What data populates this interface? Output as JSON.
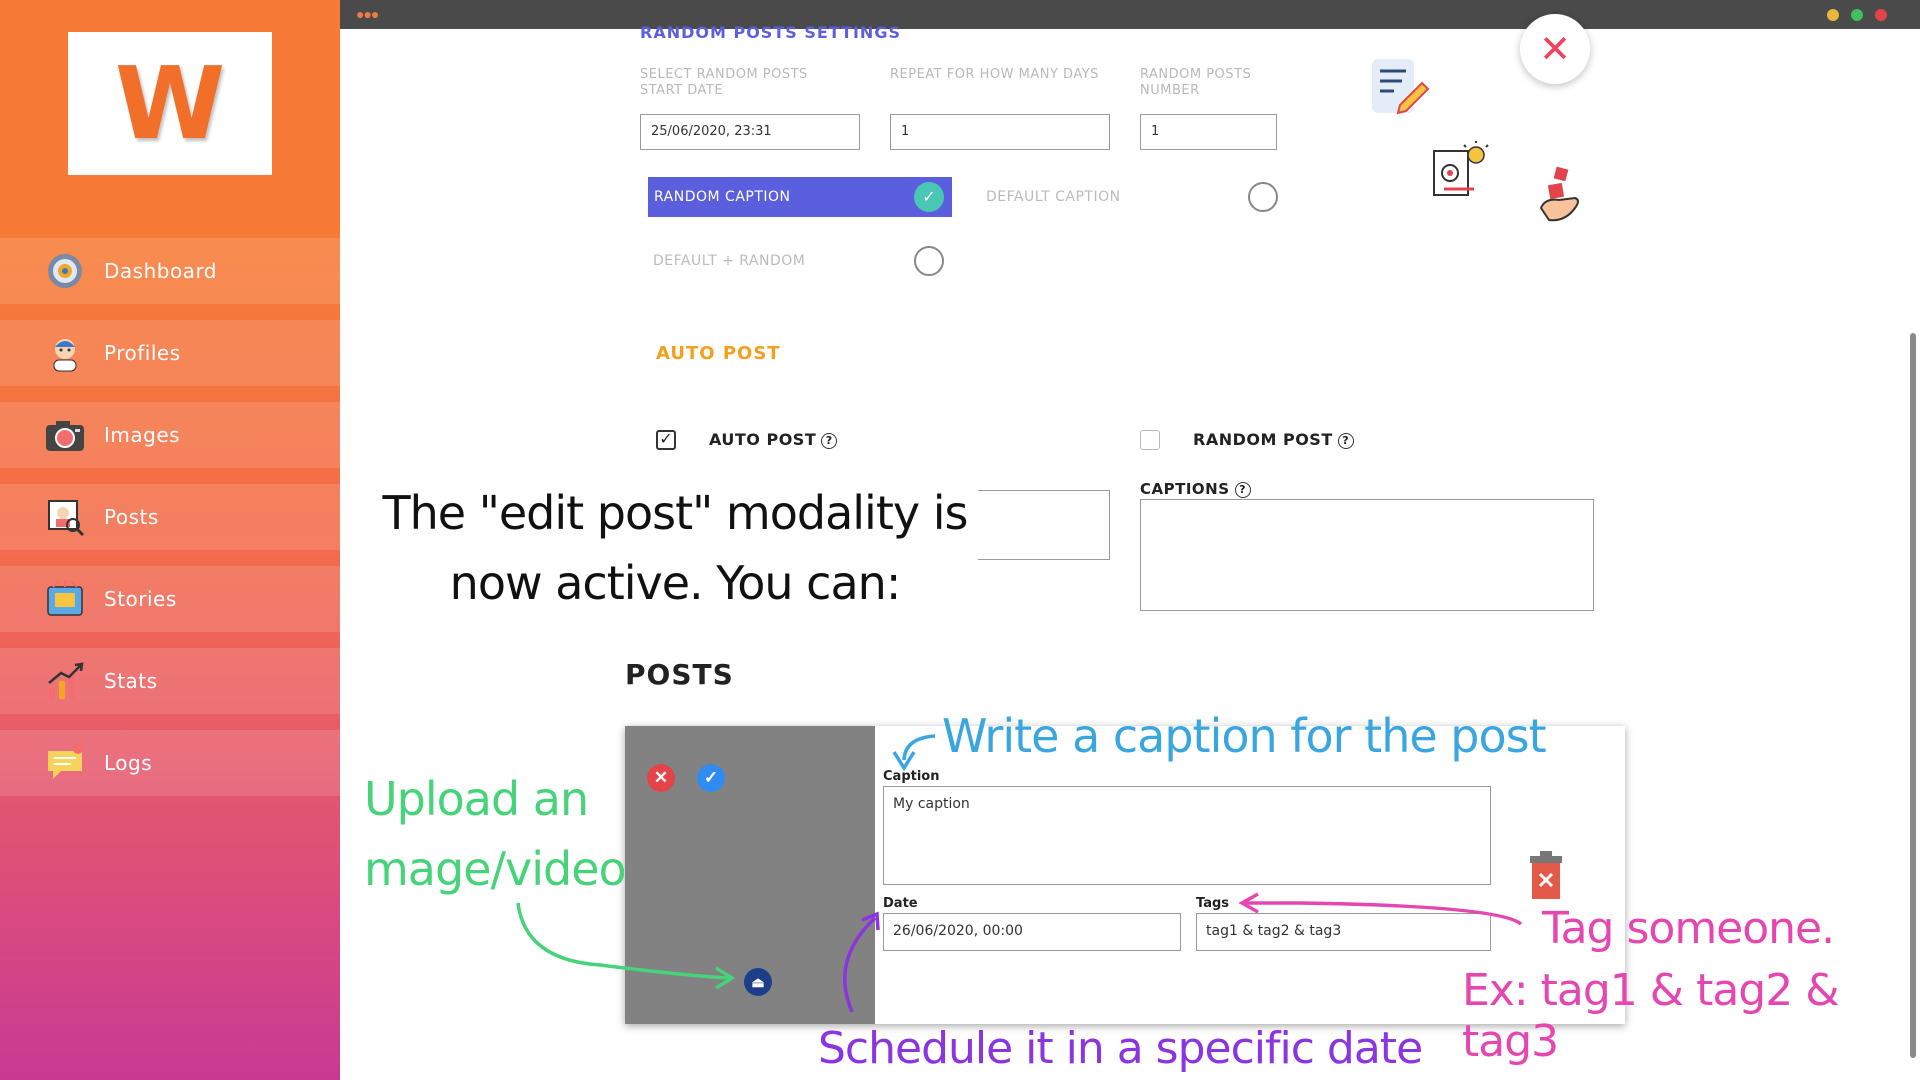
{
  "app": {
    "logo_letter": "W",
    "accent": "#f77b36",
    "brand_purple": "#5b5fde"
  },
  "sidebar": {
    "items": [
      {
        "label": "Dashboard",
        "icon": "dashboard-icon"
      },
      {
        "label": "Profiles",
        "icon": "profile-icon"
      },
      {
        "label": "Images",
        "icon": "camera-icon"
      },
      {
        "label": "Posts",
        "icon": "posts-icon"
      },
      {
        "label": "Stories",
        "icon": "stories-icon"
      },
      {
        "label": "Stats",
        "icon": "stats-icon"
      },
      {
        "label": "Logs",
        "icon": "logs-icon"
      }
    ]
  },
  "random_settings": {
    "title": "RANDOM POSTS SETTINGS",
    "start_date_label": "SELECT RANDOM POSTS START DATE",
    "start_date_value": "25/06/2020, 23:31",
    "repeat_label": "REPEAT FOR HOW MANY DAYS",
    "repeat_value": "1",
    "number_label": "RANDOM POSTS NUMBER",
    "number_value": "1",
    "caption_options": {
      "random": "RANDOM CAPTION",
      "default": "DEFAULT CAPTION",
      "default_random": "DEFAULT + RANDOM"
    },
    "selected_caption": "RANDOM CAPTION"
  },
  "auto_post": {
    "title": "AUTO POST",
    "auto_post_label": "AUTO POST",
    "auto_post_checked": true,
    "random_post_label": "RANDOM POST",
    "random_post_checked": false,
    "captions_label": "CAPTIONS",
    "help_glyph": "?"
  },
  "tutorial": {
    "headline_line1": "The \"edit post\" modality is",
    "headline_line2": "now active. You can:",
    "caption_note": "Write a caption for the post",
    "upload_note_line1": "Upload an",
    "upload_note_line2": "mage/video",
    "tag_note_line1": "Tag someone.",
    "tag_note_line2": "Ex: tag1 & tag2 & tag3",
    "schedule_note": "Schedule it in a specific date"
  },
  "posts": {
    "title": "POSTS",
    "card": {
      "caption_label": "Caption",
      "caption_value": "My caption",
      "date_label": "Date",
      "date_value": "26/06/2020, 00:00",
      "tags_label": "Tags",
      "tags_value": "tag1 & tag2 & tag3"
    }
  },
  "close_glyph": "✕"
}
